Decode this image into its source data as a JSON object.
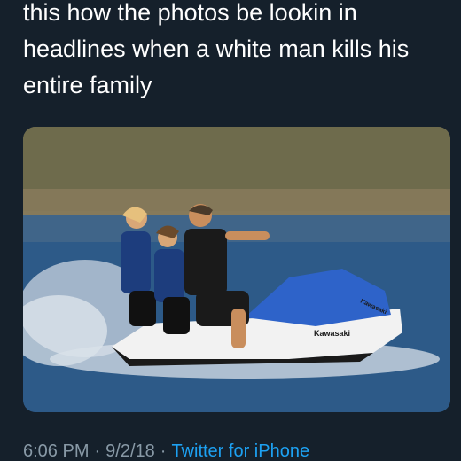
{
  "tweet": {
    "text_lines": [
      "this how the photos be lookin in",
      "headlines when a white man kills his",
      "entire family"
    ],
    "media": {
      "jet_ski_brand_side": "Kawasaki",
      "jet_ski_brand_front": "Kawasaki"
    },
    "meta": {
      "time": "6:06 PM",
      "separator": "·",
      "date": "9/2/18",
      "source": "Twitter for iPhone"
    }
  },
  "colors": {
    "background": "#15202b",
    "text": "#ffffff",
    "meta_text": "#8899a6",
    "link": "#1da1f2"
  }
}
